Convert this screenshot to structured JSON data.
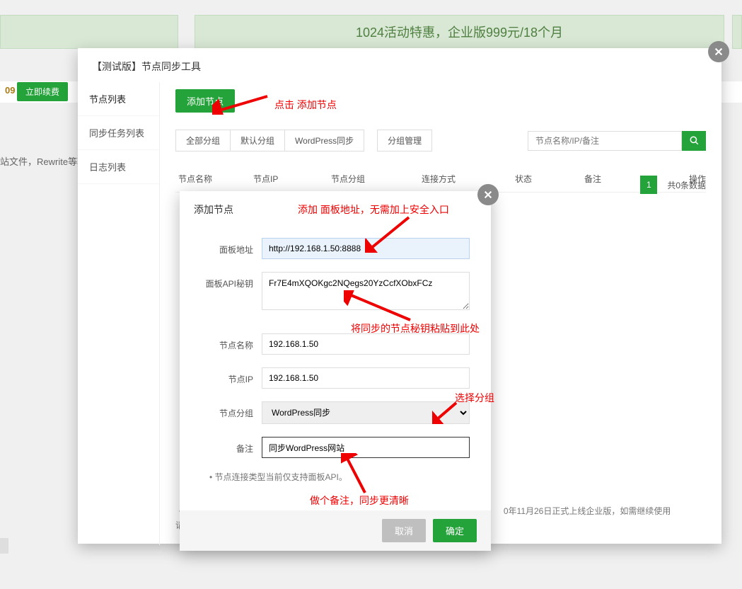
{
  "banner": {
    "text": "1024活动特惠，企业版999元/18个月"
  },
  "bg": {
    "tag09": "09",
    "renew": "立即续费",
    "rewrite": "站文件，Rewrite等项"
  },
  "modal1": {
    "title": "【测试版】节点同步工具",
    "tabs": [
      "节点列表",
      "同步任务列表",
      "日志列表"
    ],
    "add_btn": "添加节点",
    "filters": [
      "全部分组",
      "默认分组",
      "WordPress同步"
    ],
    "group_manage": "分组管理",
    "search_placeholder": "节点名称/IP/备注",
    "columns": [
      "节点名称",
      "节点IP",
      "节点分组",
      "连接方式",
      "状态",
      "备注",
      "操作"
    ],
    "pager": {
      "current": "1",
      "total_text": "共0条数据"
    },
    "bottom_note": "0年11月26日正式上线企业版，如需继续使用",
    "bottom_note_prefix": "请购"
  },
  "modal2": {
    "title": "添加节点",
    "labels": {
      "panel_url": "面板地址",
      "api_key": "面板API秘钥",
      "node_name": "节点名称",
      "node_ip": "节点IP",
      "node_group": "节点分组",
      "remark": "备注"
    },
    "values": {
      "panel_url": "http://192.168.1.50:8888",
      "api_key": "Fr7E4mXQOKgc2NQegs20YzCcfXObxFCz",
      "node_name": "192.168.1.50",
      "node_ip": "192.168.1.50",
      "node_group": "WordPress同步",
      "remark": "同步WordPress网站"
    },
    "note": "节点连接类型当前仅支持面板API。",
    "cancel": "取消",
    "confirm": "确定"
  },
  "annotations": {
    "a1": "点击  添加节点",
    "a2": "添加 面板地址，无需加上安全入口",
    "a3": "将同步的节点秘钥粘贴到此处",
    "a4": "选择分组",
    "a5": "做个备注，同步更清晰"
  }
}
